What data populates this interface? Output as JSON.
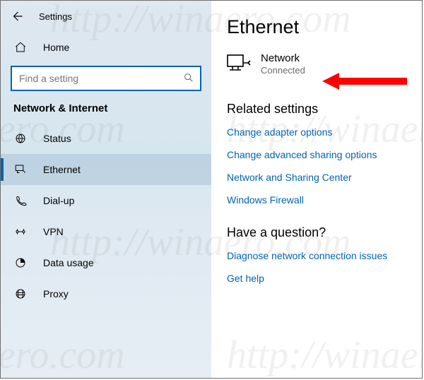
{
  "titlebar": {
    "title": "Settings"
  },
  "search": {
    "placeholder": "Find a setting"
  },
  "home_label": "Home",
  "section_label": "Network & Internet",
  "nav": {
    "status": "Status",
    "ethernet": "Ethernet",
    "dialup": "Dial-up",
    "vpn": "VPN",
    "data_usage": "Data usage",
    "proxy": "Proxy"
  },
  "page": {
    "title": "Ethernet",
    "connection": {
      "name": "Network",
      "status": "Connected"
    },
    "related_head": "Related settings",
    "links": {
      "adapter": "Change adapter options",
      "sharing": "Change advanced sharing options",
      "center": "Network and Sharing Center",
      "firewall": "Windows Firewall"
    },
    "question_head": "Have a question?",
    "qlinks": {
      "diagnose": "Diagnose network connection issues",
      "help": "Get help"
    }
  },
  "watermark": "http://winaero.com"
}
